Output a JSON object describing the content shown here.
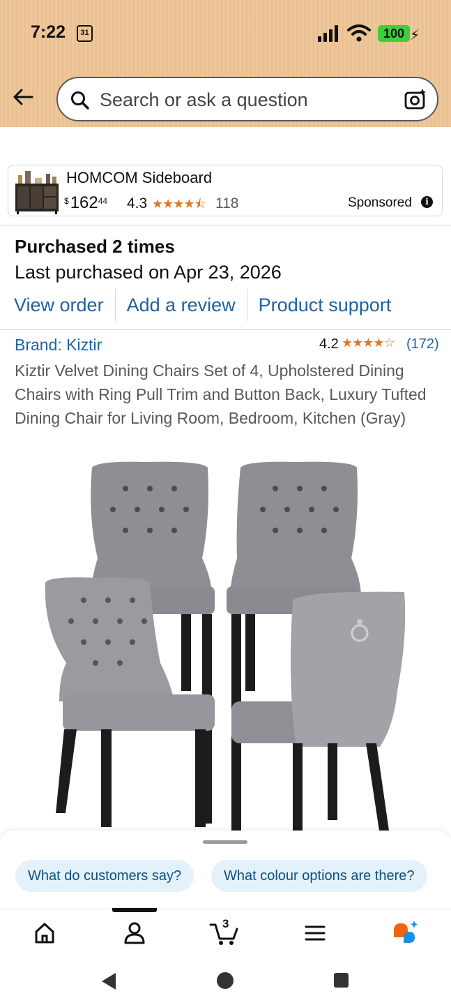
{
  "status_bar": {
    "time": "7:22",
    "calendar_day": "31",
    "battery": "100"
  },
  "search": {
    "placeholder": "Search or ask a question"
  },
  "ad": {
    "title": "HOMCOM Sideboard",
    "price_currency": "$",
    "price_whole": "162",
    "price_fraction": "44",
    "rating": "4.3",
    "stars": "★★★★⯪",
    "rating_count": "118",
    "sponsored_label": "Sponsored"
  },
  "purchase": {
    "purchased_times": "Purchased 2 times",
    "last_purchased": "Last purchased on Apr 23, 2026",
    "actions": [
      "View order",
      "Add a review",
      "Product support"
    ]
  },
  "product": {
    "brand": "Brand: Kiztir",
    "rating": "4.2",
    "stars": "★★★★☆",
    "rating_count": "(172)",
    "title": "Kiztir Velvet Dining Chairs Set of 4, Upholstered Dining Chairs with Ring Pull Trim and Button Back, Luxury Tufted Dining Chair for Living Room, Bedroom, Kitchen (Gray)"
  },
  "suggestions": [
    "What do customers say?",
    "What colour options are there?"
  ],
  "bottom_nav": {
    "items": [
      "home-icon",
      "account-icon",
      "cart-icon",
      "menu-icon",
      "rufus-icon"
    ],
    "cart_count": "3",
    "active": "account"
  },
  "colors": {
    "link": "#2162a1",
    "star": "#de7921",
    "header_bg": "#ecc496",
    "chip_bg": "#e3f1fb"
  }
}
